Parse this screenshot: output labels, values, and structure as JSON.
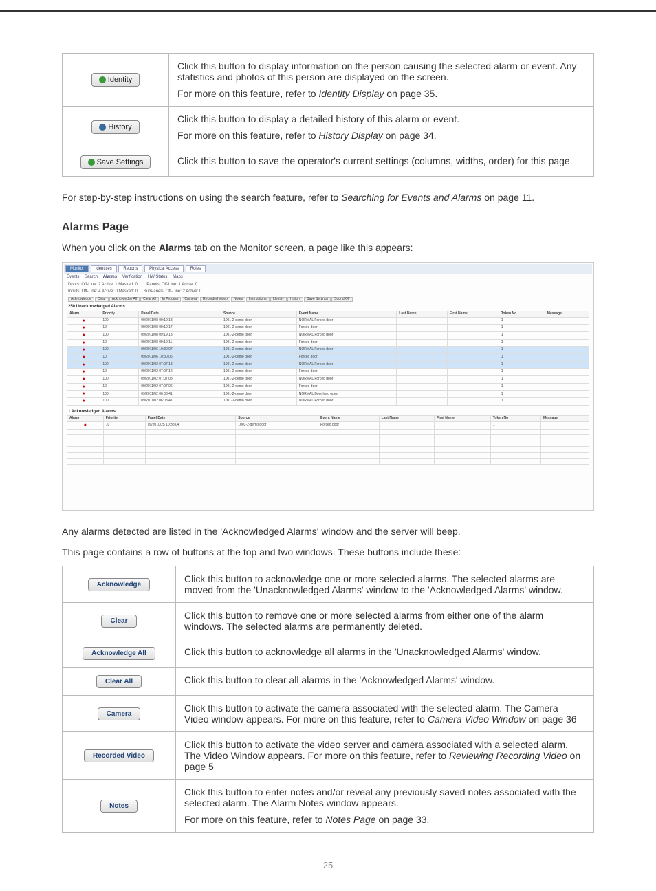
{
  "table1": {
    "rows": [
      {
        "button": "Identity",
        "icon": "green",
        "desc1": "Click this button to display information on the person causing the selected alarm or event. Any statistics and photos of this person are displayed on the screen.",
        "desc2": "For more on this feature, refer to ",
        "desc2_em": "Identity Display",
        "desc2_after": " on page 35."
      },
      {
        "button": "History",
        "icon": "blue",
        "desc1": "Click this button to display a detailed history of this alarm or event.",
        "desc2": "For more on this feature, refer to ",
        "desc2_em": "History Display",
        "desc2_after": " on page 34."
      },
      {
        "button": "Save Settings",
        "icon": "green",
        "desc1": "Click this button to save the operator's current settings (columns, widths, order) for this page."
      }
    ]
  },
  "para1_a": "For step-by-step instructions on using the search feature, refer to ",
  "para1_em": "Searching for Events and Alarms",
  "para1_b": " on page 11.",
  "heading": "Alarms Page",
  "para2_a": "When you click on the ",
  "para2_b": "Alarms",
  "para2_c": " tab on the Monitor screen, a page like this appears:",
  "screenshot": {
    "tabs": [
      "Monitor",
      "Identities",
      "Reports",
      "Physical Access",
      "Roles"
    ],
    "subtabs": [
      "Events",
      "Search",
      "Alarms",
      "Verification",
      "HW Status",
      "Maps"
    ],
    "status1": "Doors: Off-Line: 2  Active: 1  Masked: 0",
    "status2": "Panels: Off-Line: 1  Active: 0",
    "status3": "Inputs: Off-Line: 4  Active: 0  Masked: 0",
    "status4": "SubPanels: Off-Line: 2  Active: 0",
    "buttons": [
      "Acknowledge",
      "Clear",
      "Acknowledge All",
      "Clear All",
      "In Process",
      "Camera",
      "Recorded Video",
      "Notes",
      "Instructions",
      "Identity",
      "History",
      "Save Settings",
      "Sound Off"
    ],
    "section1": "250 Unacknowledged Alarms",
    "section2": "1 Acknowledged Alarms",
    "headers": [
      "Alarm",
      "Priority",
      "Panel Date",
      "Source",
      "Event Name",
      "Last Name",
      "First Name",
      "Token No",
      "Message"
    ],
    "rows": [
      {
        "p": "100",
        "d": "09/2011/08 09:19:18",
        "s": "1001-2-demo door",
        "e": "NORMAL Forced door",
        "t": "1"
      },
      {
        "p": "10",
        "d": "09/2011/08 09:19:17",
        "s": "1001-2-demo door",
        "e": "Forced door",
        "t": "1"
      },
      {
        "p": "100",
        "d": "09/2011/08 09:19:13",
        "s": "1001-2-demo door",
        "e": "NORMAL Forced door",
        "t": "1"
      },
      {
        "p": "10",
        "d": "09/2011/08 09:19:11",
        "s": "1001-2-demo door",
        "e": "Forced door",
        "t": "1"
      },
      {
        "p": "100",
        "d": "09/2011/06 10:30:07",
        "s": "1001-2-demo door",
        "e": "NORMAL Forced door",
        "t": "1",
        "sel": true
      },
      {
        "p": "10",
        "d": "09/2011/06 10:30:05",
        "s": "1001-2-demo door",
        "e": "Forced door",
        "t": "1",
        "sel": true
      },
      {
        "p": "100",
        "d": "09/2011/02 07:07:18",
        "s": "1001-2-demo door",
        "e": "NORMAL Forced door",
        "t": "1",
        "sel": true
      },
      {
        "p": "10",
        "d": "09/2011/02 07:07:12",
        "s": "1001-2-demo door",
        "e": "Forced door",
        "t": "1"
      },
      {
        "p": "100",
        "d": "09/2011/02 07:07:08",
        "s": "1001-2-demo door",
        "e": "NORMAL Forced door",
        "t": "1"
      },
      {
        "p": "10",
        "d": "09/2011/02 07:07:06",
        "s": "1001-2-demo door",
        "e": "Forced door",
        "t": "1"
      },
      {
        "p": "100",
        "d": "09/2011/02 06:08:41",
        "s": "1001-2-demo door",
        "e": "NORMAL Door held open",
        "t": "1"
      },
      {
        "p": "100",
        "d": "09/2011/02 06:08:41",
        "s": "1001-2-demo door",
        "e": "NORMAL Forced door",
        "t": "1"
      }
    ],
    "ackrows": [
      {
        "p": "10",
        "d": "09/2010/25 10:38:04",
        "s": "1001-2-demo door",
        "e": "Forced door",
        "t": "1"
      }
    ]
  },
  "para3": "Any alarms detected are listed in the 'Acknowledged Alarms' window and the server will beep.",
  "para4": "This page contains a row of buttons at the top and two windows. These buttons include these:",
  "table2": {
    "rows": [
      {
        "button": "Acknowledge",
        "desc": "Click this button to acknowledge one or more selected alarms. The selected alarms are moved from the 'Unacknowledged Alarms' window to the 'Acknowledged Alarms' window."
      },
      {
        "button": "Clear",
        "desc": "Click this button to remove one or more selected alarms from either one of the alarm windows. The selected alarms are permanently deleted."
      },
      {
        "button": "Acknowledge All",
        "desc": "Click this button to acknowledge all alarms in the 'Unacknowledged Alarms' window."
      },
      {
        "button": "Clear All",
        "desc": "Click this button to clear all alarms in the 'Acknowledged Alarms' window."
      },
      {
        "button": "Camera",
        "desc": "Click this button to activate the camera associated with the selected alarm. The Camera Video window appears. For more on this feature, refer to ",
        "em": "Camera Video Window",
        "after": " on page 36"
      },
      {
        "button": "Recorded Video",
        "desc": "Click this button to activate the video server and camera associated with a selected alarm. The Video Window appears. For more on this feature, refer to ",
        "em": "Reviewing Recording Video",
        "after": " on page 5"
      },
      {
        "button": "Notes",
        "desc": "Click this button to enter notes and/or reveal any previously saved notes associated with the selected alarm. The Alarm Notes window appears.",
        "desc2": "For more on this feature, refer to ",
        "em2": "Notes Page",
        "after2": " on page 33."
      }
    ]
  },
  "page_number": "25"
}
